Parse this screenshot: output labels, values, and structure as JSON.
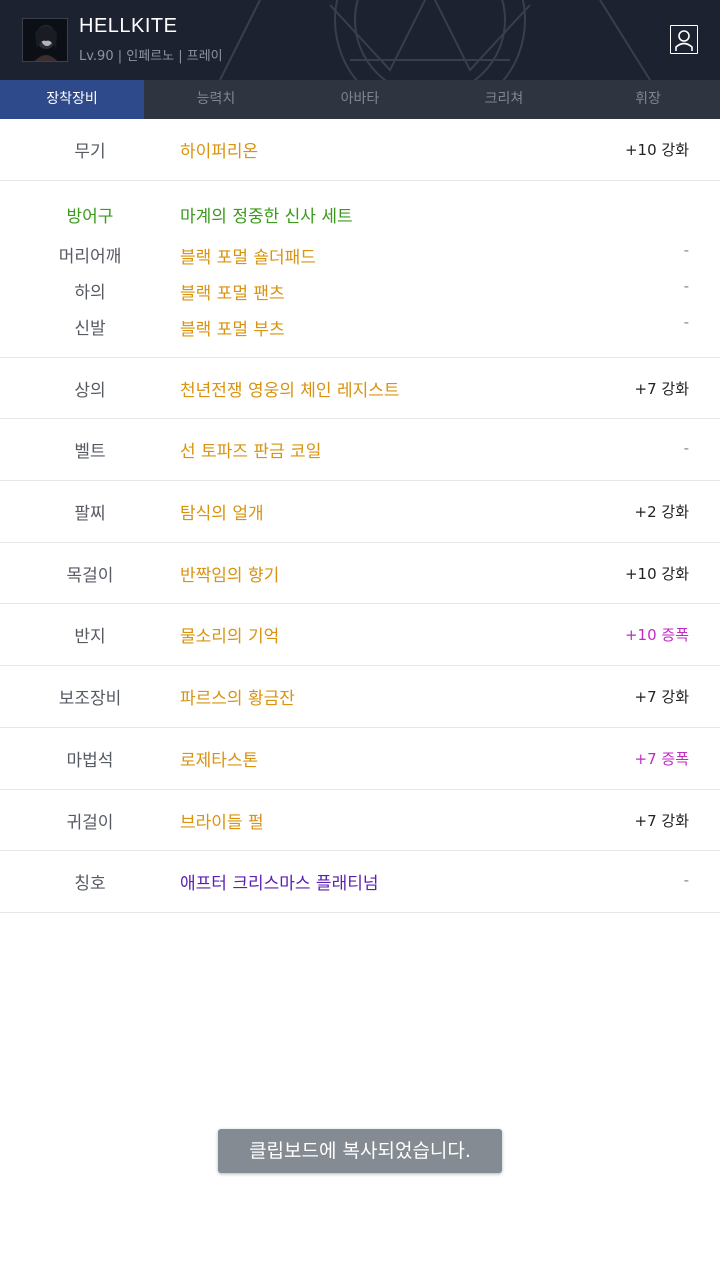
{
  "header": {
    "character_name": "HELLKITE",
    "subtitle": "Lv.90 | 인페르노 | 프레이",
    "profile_icon": "person-icon"
  },
  "tabs": [
    {
      "label": "장착장비",
      "active": true
    },
    {
      "label": "능력치",
      "active": false
    },
    {
      "label": "아바타",
      "active": false
    },
    {
      "label": "크리쳐",
      "active": false
    },
    {
      "label": "휘장",
      "active": false
    }
  ],
  "equipment": {
    "weapon": {
      "slot": "무기",
      "item": "하이퍼리온",
      "enhance": "+10 강화"
    },
    "armor_set": {
      "slot": "방어구",
      "set_name": "마계의 정중한 신사 세트",
      "pieces": [
        {
          "slot": "머리어깨",
          "item": "블랙 포멀 숄더패드",
          "enhance": "-"
        },
        {
          "slot": "하의",
          "item": "블랙 포멀 팬츠",
          "enhance": "-"
        },
        {
          "slot": "신발",
          "item": "블랙 포멀 부츠",
          "enhance": "-"
        }
      ]
    },
    "rows": [
      {
        "slot": "상의",
        "item": "천년전쟁 영웅의 체인 레지스트",
        "enhance": "+7 강화",
        "style": "normal"
      },
      {
        "slot": "벨트",
        "item": "선 토파즈 판금 코일",
        "enhance": "-",
        "style": "dash"
      },
      {
        "slot": "팔찌",
        "item": "탐식의 얼개",
        "enhance": "+2 강화",
        "style": "normal"
      },
      {
        "slot": "목걸이",
        "item": "반짝임의 향기",
        "enhance": "+10 강화",
        "style": "normal"
      },
      {
        "slot": "반지",
        "item": "물소리의 기억",
        "enhance": "+10 증폭",
        "style": "pink"
      },
      {
        "slot": "보조장비",
        "item": "파르스의 황금잔",
        "enhance": "+7 강화",
        "style": "normal"
      },
      {
        "slot": "마법석",
        "item": "로제타스톤",
        "enhance": "+7 증폭",
        "style": "pink"
      },
      {
        "slot": "귀걸이",
        "item": "브라이들 펄",
        "enhance": "+7 강화",
        "style": "normal"
      }
    ],
    "title": {
      "slot": "칭호",
      "item": "애프터 크리스마스 플래티넘",
      "enhance": "-"
    }
  },
  "toast": {
    "message": "클립보드에 복사되었습니다."
  },
  "colors": {
    "header_bg": "#1c2230",
    "tab_bar_bg": "#2e3440",
    "tab_active_bg": "#2f4a8a",
    "item_gold": "#d9930f",
    "set_green": "#3a9a1c",
    "amplify_pink": "#c22bc2",
    "title_purple": "#5b1fb3"
  }
}
